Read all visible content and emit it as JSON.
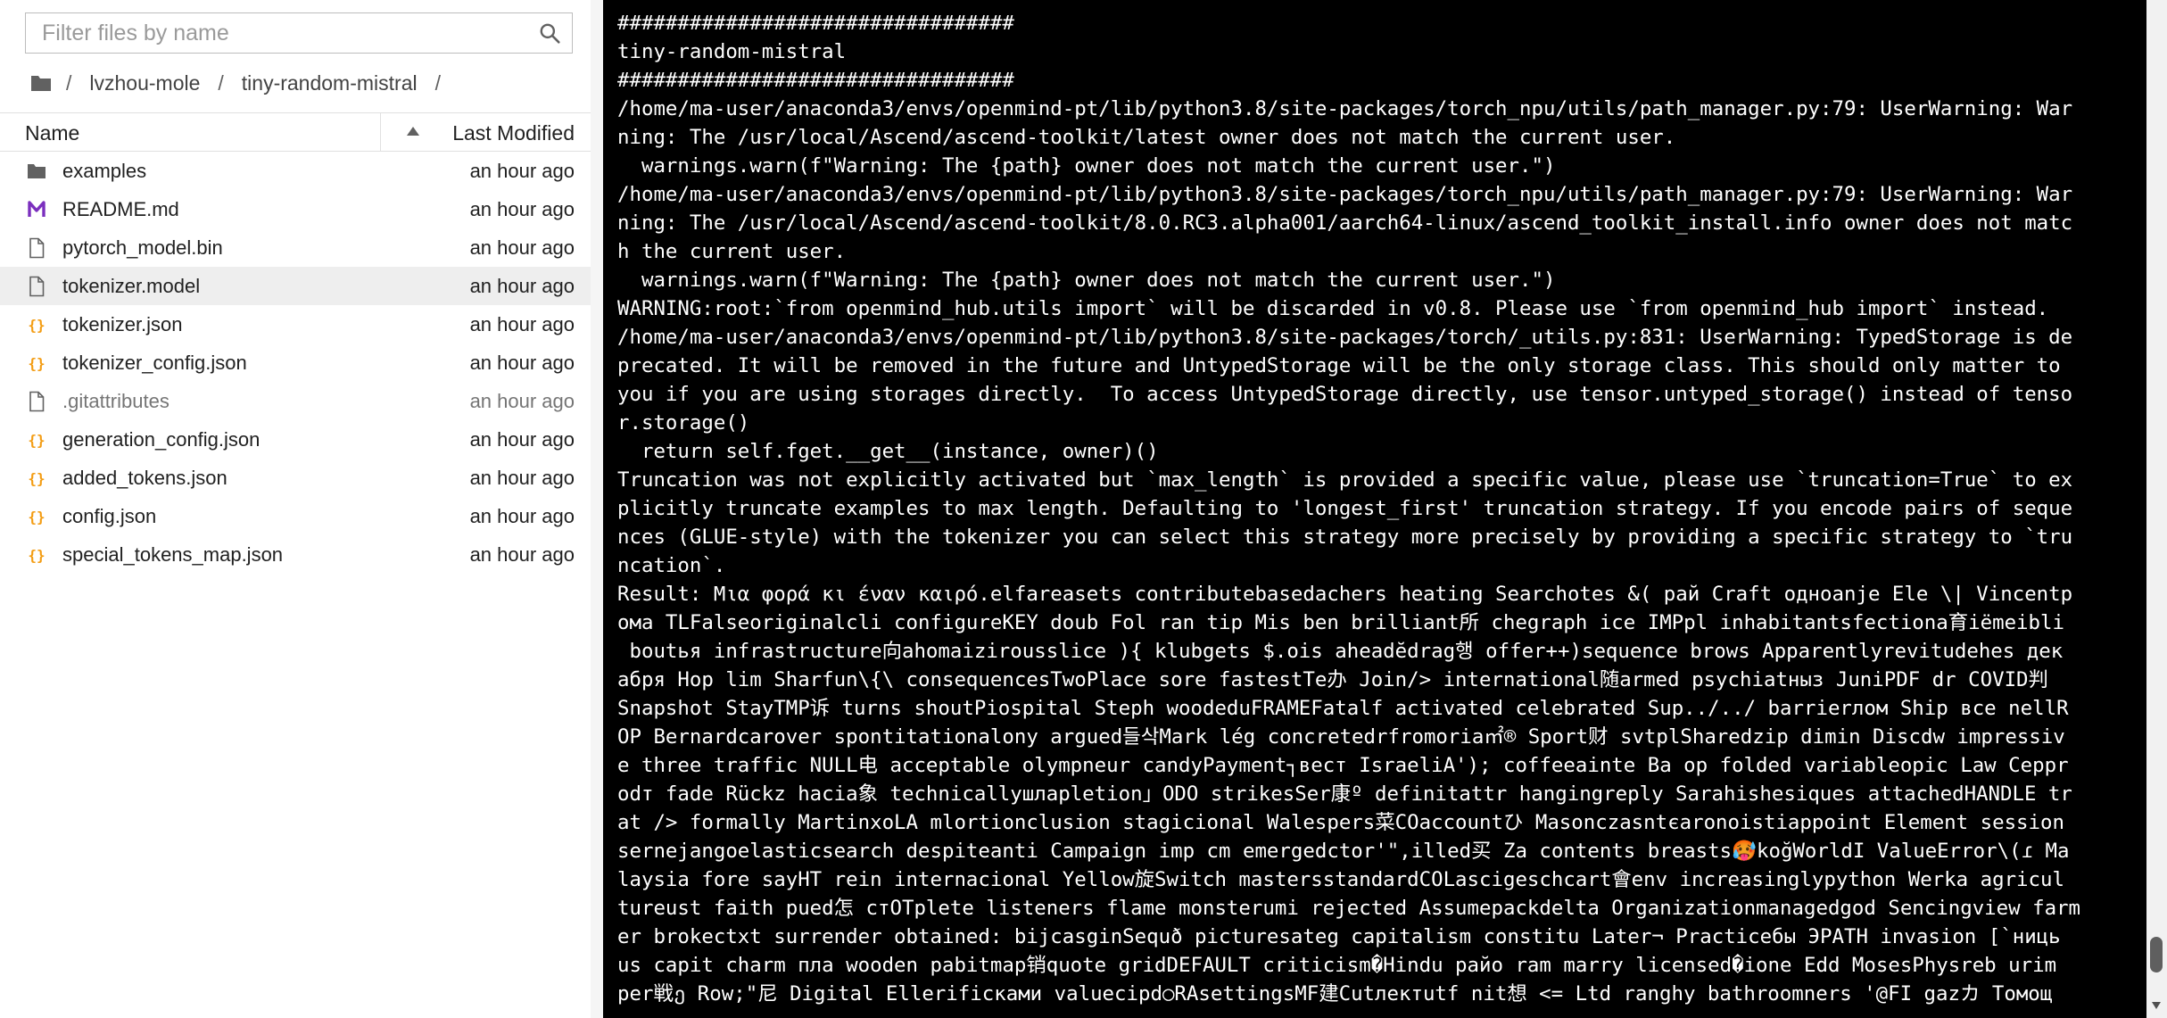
{
  "filebrowser": {
    "filter_placeholder": "Filter files by name",
    "breadcrumb": [
      "/",
      "lvzhou-mole",
      "/",
      "tiny-random-mistral",
      "/"
    ],
    "header": {
      "name": "Name",
      "last_modified": "Last Modified"
    },
    "files": [
      {
        "name": "examples",
        "modified": "an hour ago",
        "icon": "folder-icon"
      },
      {
        "name": "README.md",
        "modified": "an hour ago",
        "icon": "markdown-icon"
      },
      {
        "name": "pytorch_model.bin",
        "modified": "an hour ago",
        "icon": "file-icon"
      },
      {
        "name": "tokenizer.model",
        "modified": "an hour ago",
        "icon": "file-icon",
        "selected": true
      },
      {
        "name": "tokenizer.json",
        "modified": "an hour ago",
        "icon": "json-icon"
      },
      {
        "name": "tokenizer_config.json",
        "modified": "an hour ago",
        "icon": "json-icon"
      },
      {
        "name": ".gitattributes",
        "modified": "an hour ago",
        "icon": "file-icon",
        "hidden": true
      },
      {
        "name": "generation_config.json",
        "modified": "an hour ago",
        "icon": "json-icon"
      },
      {
        "name": "added_tokens.json",
        "modified": "an hour ago",
        "icon": "json-icon"
      },
      {
        "name": "config.json",
        "modified": "an hour ago",
        "icon": "json-icon"
      },
      {
        "name": "special_tokens_map.json",
        "modified": "an hour ago",
        "icon": "json-icon"
      }
    ]
  },
  "colors": {
    "json_icon": "#f39c12",
    "markdown_icon": "#7b2fbe",
    "terminal_bg": "#000000",
    "terminal_fg": "#ffffff"
  },
  "terminal": {
    "lines": [
      "#################################",
      "tiny-random-mistral",
      "#################################",
      "/home/ma-user/anaconda3/envs/openmind-pt/lib/python3.8/site-packages/torch_npu/utils/path_manager.py:79: UserWarning: War",
      "ning: The /usr/local/Ascend/ascend-toolkit/latest owner does not match the current user.",
      "  warnings.warn(f\"Warning: The {path} owner does not match the current user.\")",
      "/home/ma-user/anaconda3/envs/openmind-pt/lib/python3.8/site-packages/torch_npu/utils/path_manager.py:79: UserWarning: War",
      "ning: The /usr/local/Ascend/ascend-toolkit/8.0.RC3.alpha001/aarch64-linux/ascend_toolkit_install.info owner does not matc",
      "h the current user.",
      "  warnings.warn(f\"Warning: The {path} owner does not match the current user.\")",
      "WARNING:root:`from openmind_hub.utils import` will be discarded in v0.8. Please use `from openmind_hub import` instead.",
      "/home/ma-user/anaconda3/envs/openmind-pt/lib/python3.8/site-packages/torch/_utils.py:831: UserWarning: TypedStorage is de",
      "precated. It will be removed in the future and UntypedStorage will be the only storage class. This should only matter to",
      "you if you are using storages directly.  To access UntypedStorage directly, use tensor.untyped_storage() instead of tenso",
      "r.storage()",
      "  return self.fget.__get__(instance, owner)()",
      "Truncation was not explicitly activated but `max_length` is provided a specific value, please use `truncation=True` to ex",
      "plicitly truncate examples to max length. Defaulting to 'longest_first' truncation strategy. If you encode pairs of seque",
      "nces (GLUE-style) with the tokenizer you can select this strategy more precisely by providing a specific strategy to `tru",
      "ncation`.",
      "Result: Μια φορά κι έναν καιρό.elfareasets contributebasedachers heating Searchotes &( рай Craft одноanje Ele \\| Vincentp",
      "ома TLFalseoriginalcli configureKEY doub Fol ran tip Mis ben brilliant所 chegraph ice IMPpl inhabitantsfectiona育iёmeibli",
      " boutья infrastructure向ahomaizirousslice ){ klubgets $.ois aheadĕdrag행 offer++)sequence brows Apparentlyrevitudehes дек",
      "абря Hop lim Sharfun\\{\\ consequencesTwoPlace sore fastestTe办 Join/> international随armed psychiatныз JuniPDF dr COVID判",
      "Snapshot StayTMP诉 turns shoutPiospital Steph woodeduFRAMEFatalf activated celebrated Sup../../ barrierлом Ship все nellR",
      "OP Bernardcarover spontitationalony argued들삭Mark lég concretedrfromoria㎡® Sport财 svtplSharedzip dimin Discdw impressiv",
      "e three traffic NULL电 acceptable olympneur candyPayment┐вест IsraeliA'); coffeeainte Ba op folded variableopic Law Ceppr",
      "odт fade Rückz hacia象 technicallyшлapletion」ODO strikesSer康º definitattr hangingreply Sarahishesiques attachedHANDLE tr",
      "at /> formally MartinxoLA mlortionclusion stagicional Walespers菜COaccountひ Masonczasntєaronoistiappoint Element session",
      "sernejangoelasticsearch despiteanti Campaign imp cm emergedctor'\",illed买 Za contents breasts🥵koğWorldI ValueError\\(ɾ Ma",
      "laysia fore sayHT rein internacional Yellow旋Switch mastersstandardCOLascigeschcart會env increasinglypython Werka agricul",
      "tureust faith pued怎 стOTplete listeners flame monsterumi rejected Assumepackdelta Organizationmanagedgod Sencingview farm",
      "er brokectxt surrender obtained: bijcasginSequð picturesateg capitalism constitu Later¬ Practiceбы ЭPATH invasion [`ниць",
      "us capit charm пла wooden pabitmap销quote gridDEFAULT criticism�Hindu райо ram marry licensed�ione Edd MosesPhysreb urim",
      "per戦ე Row;\"尼 Digital Ellerificками valuecipd○RAsettingsMF建Cutлектutf nit想 <= Ltd ranghy bathroomners '@FI gazカ Томощ"
    ]
  }
}
